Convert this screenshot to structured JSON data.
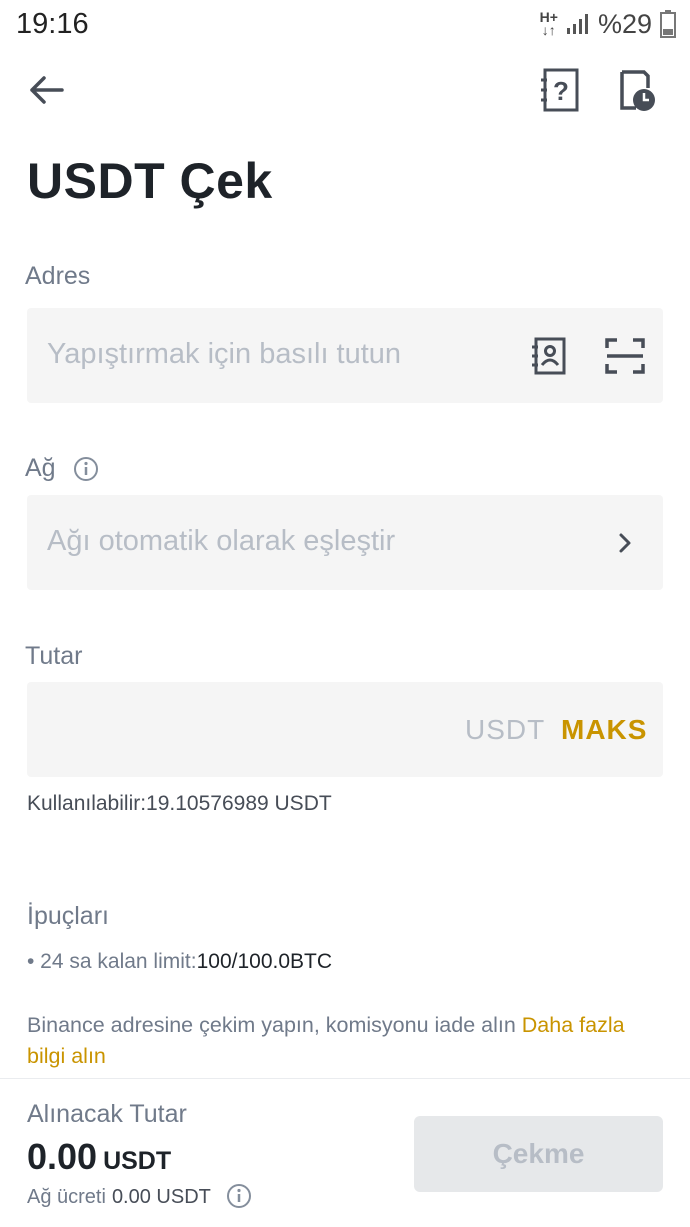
{
  "status_bar": {
    "time": "19:16",
    "network": "H+",
    "battery": "%29"
  },
  "header": {
    "back_icon": "arrow-left-icon",
    "help_icon": "help-document-icon",
    "history_icon": "history-icon"
  },
  "title": "USDT Çek",
  "address": {
    "label": "Adres",
    "placeholder": "Yapıştırmak için basılı tutun",
    "address_book_icon": "address-book-icon",
    "scan_icon": "scan-icon"
  },
  "network": {
    "label": "Ağ",
    "placeholder": "Ağı otomatik olarak eşleştir"
  },
  "amount": {
    "label": "Tutar",
    "unit": "USDT",
    "max_label": "MAKS",
    "available": "Kullanılabilir:19.10576989 USDT"
  },
  "tips": {
    "title": "İpuçları",
    "limit_label": "• 24 sa kalan limit:",
    "limit_value": "100/100.0BTC",
    "promo_text": "Binance adresine çekim yapın, komisyonu iade alın ",
    "promo_link": "Daha fazla bilgi alın"
  },
  "footer": {
    "receive_label": "Alınacak Tutar",
    "receive_amount": "0.00",
    "receive_unit": "USDT",
    "fee_label": "Ağ ücreti",
    "fee_value": "0.00 USDT",
    "withdraw_label": "Çekme"
  },
  "colors": {
    "accent": "#c99400",
    "field_bg": "#f5f5f5",
    "text_primary": "#1e2329",
    "text_secondary": "#707a8a",
    "disabled_btn": "#e6e8ea"
  }
}
